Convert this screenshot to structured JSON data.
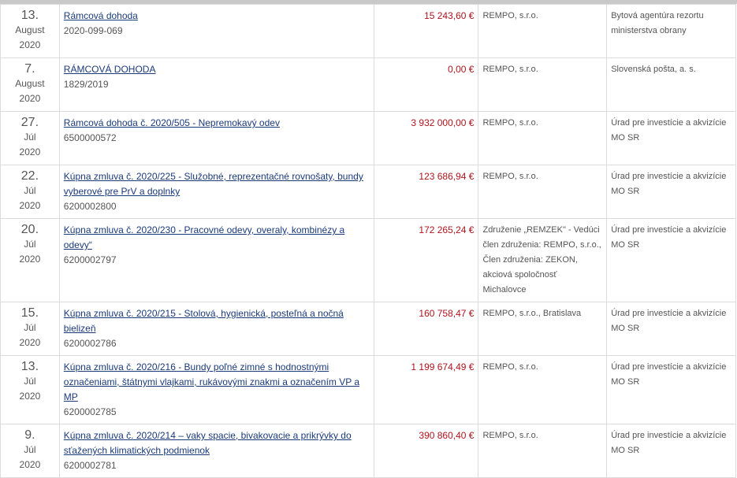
{
  "rows": [
    {
      "day": "13.",
      "month": "August",
      "year": "2020",
      "title": "Rámcová dohoda",
      "code": "2020-099-069",
      "amount": "15 243,60 €",
      "supplier": "REMPO, s.r.o.",
      "customer": "Bytová agentúra rezortu ministerstva obrany"
    },
    {
      "day": "7.",
      "month": "August",
      "year": "2020",
      "title": "RÁMCOVÁ DOHODA",
      "code": "1829/2019",
      "amount": "0,00 €",
      "supplier": "REMPO, s.r.o.",
      "customer": "Slovenská pošta, a. s."
    },
    {
      "day": "27.",
      "month": "Júl",
      "year": "2020",
      "title": "Rámcová dohoda č. 2020/505 - Nepremokavý odev",
      "code": "6500000572",
      "amount": "3 932 000,00 €",
      "supplier": "REMPO, s.r.o.",
      "customer": "Úrad pre investície a akvizície MO SR"
    },
    {
      "day": "22.",
      "month": "Júl",
      "year": "2020",
      "title": "Kúpna zmluva č. 2020/225 - Služobné, reprezentačné rovnošaty, bundy vyberové pre PrV a doplnky",
      "code": "6200002800",
      "amount": "123 686,94 €",
      "supplier": "REMPO, s.r.o.",
      "customer": "Úrad pre investície a akvizície MO SR"
    },
    {
      "day": "20.",
      "month": "Júl",
      "year": "2020",
      "title": "Kúpna zmluva č. 2020/230 - Pracovné odevy, overaly, kombinézy a odevy“",
      "code": "6200002797",
      "amount": "172 265,24 €",
      "supplier": "Združenie „REMZEK\" - Vedúci člen združenia: REMPO, s.r.o., Člen združenia: ZEKON, akciová spoločnosť Michalovce",
      "customer": "Úrad pre investície a akvizície MO SR"
    },
    {
      "day": "15.",
      "month": "Júl",
      "year": "2020",
      "title": "Kúpna zmluva č. 2020/215 - Stolová, hygienická, posteľná a nočná bielizeň",
      "code": "6200002786",
      "amount": "160 758,47 €",
      "supplier": "REMPO, s.r.o., Bratislava",
      "customer": "Úrad pre investície a akvizície MO SR"
    },
    {
      "day": "13.",
      "month": "Júl",
      "year": "2020",
      "title": "Kúpna zmluva č. 2020/216 - Bundy poľné zimné s hodnostnými označeniami, štátnymi vlajkami, rukávovými znakmi a označením VP a MP",
      "code": "6200002785",
      "amount": "1 199 674,49 €",
      "supplier": "REMPO, s.r.o.",
      "customer": "Úrad pre investície a akvizície MO SR"
    },
    {
      "day": "9.",
      "month": "Júl",
      "year": "2020",
      "title": "Kúpna zmluva č. 2020/214 – vaky spacie, bivakovacie a prikrývky do sťažených klimatických podmienok",
      "code": "6200002781",
      "amount": "390 860,40 €",
      "supplier": "REMPO, s.r.o.",
      "customer": "Úrad pre investície a akvizície MO SR"
    }
  ]
}
